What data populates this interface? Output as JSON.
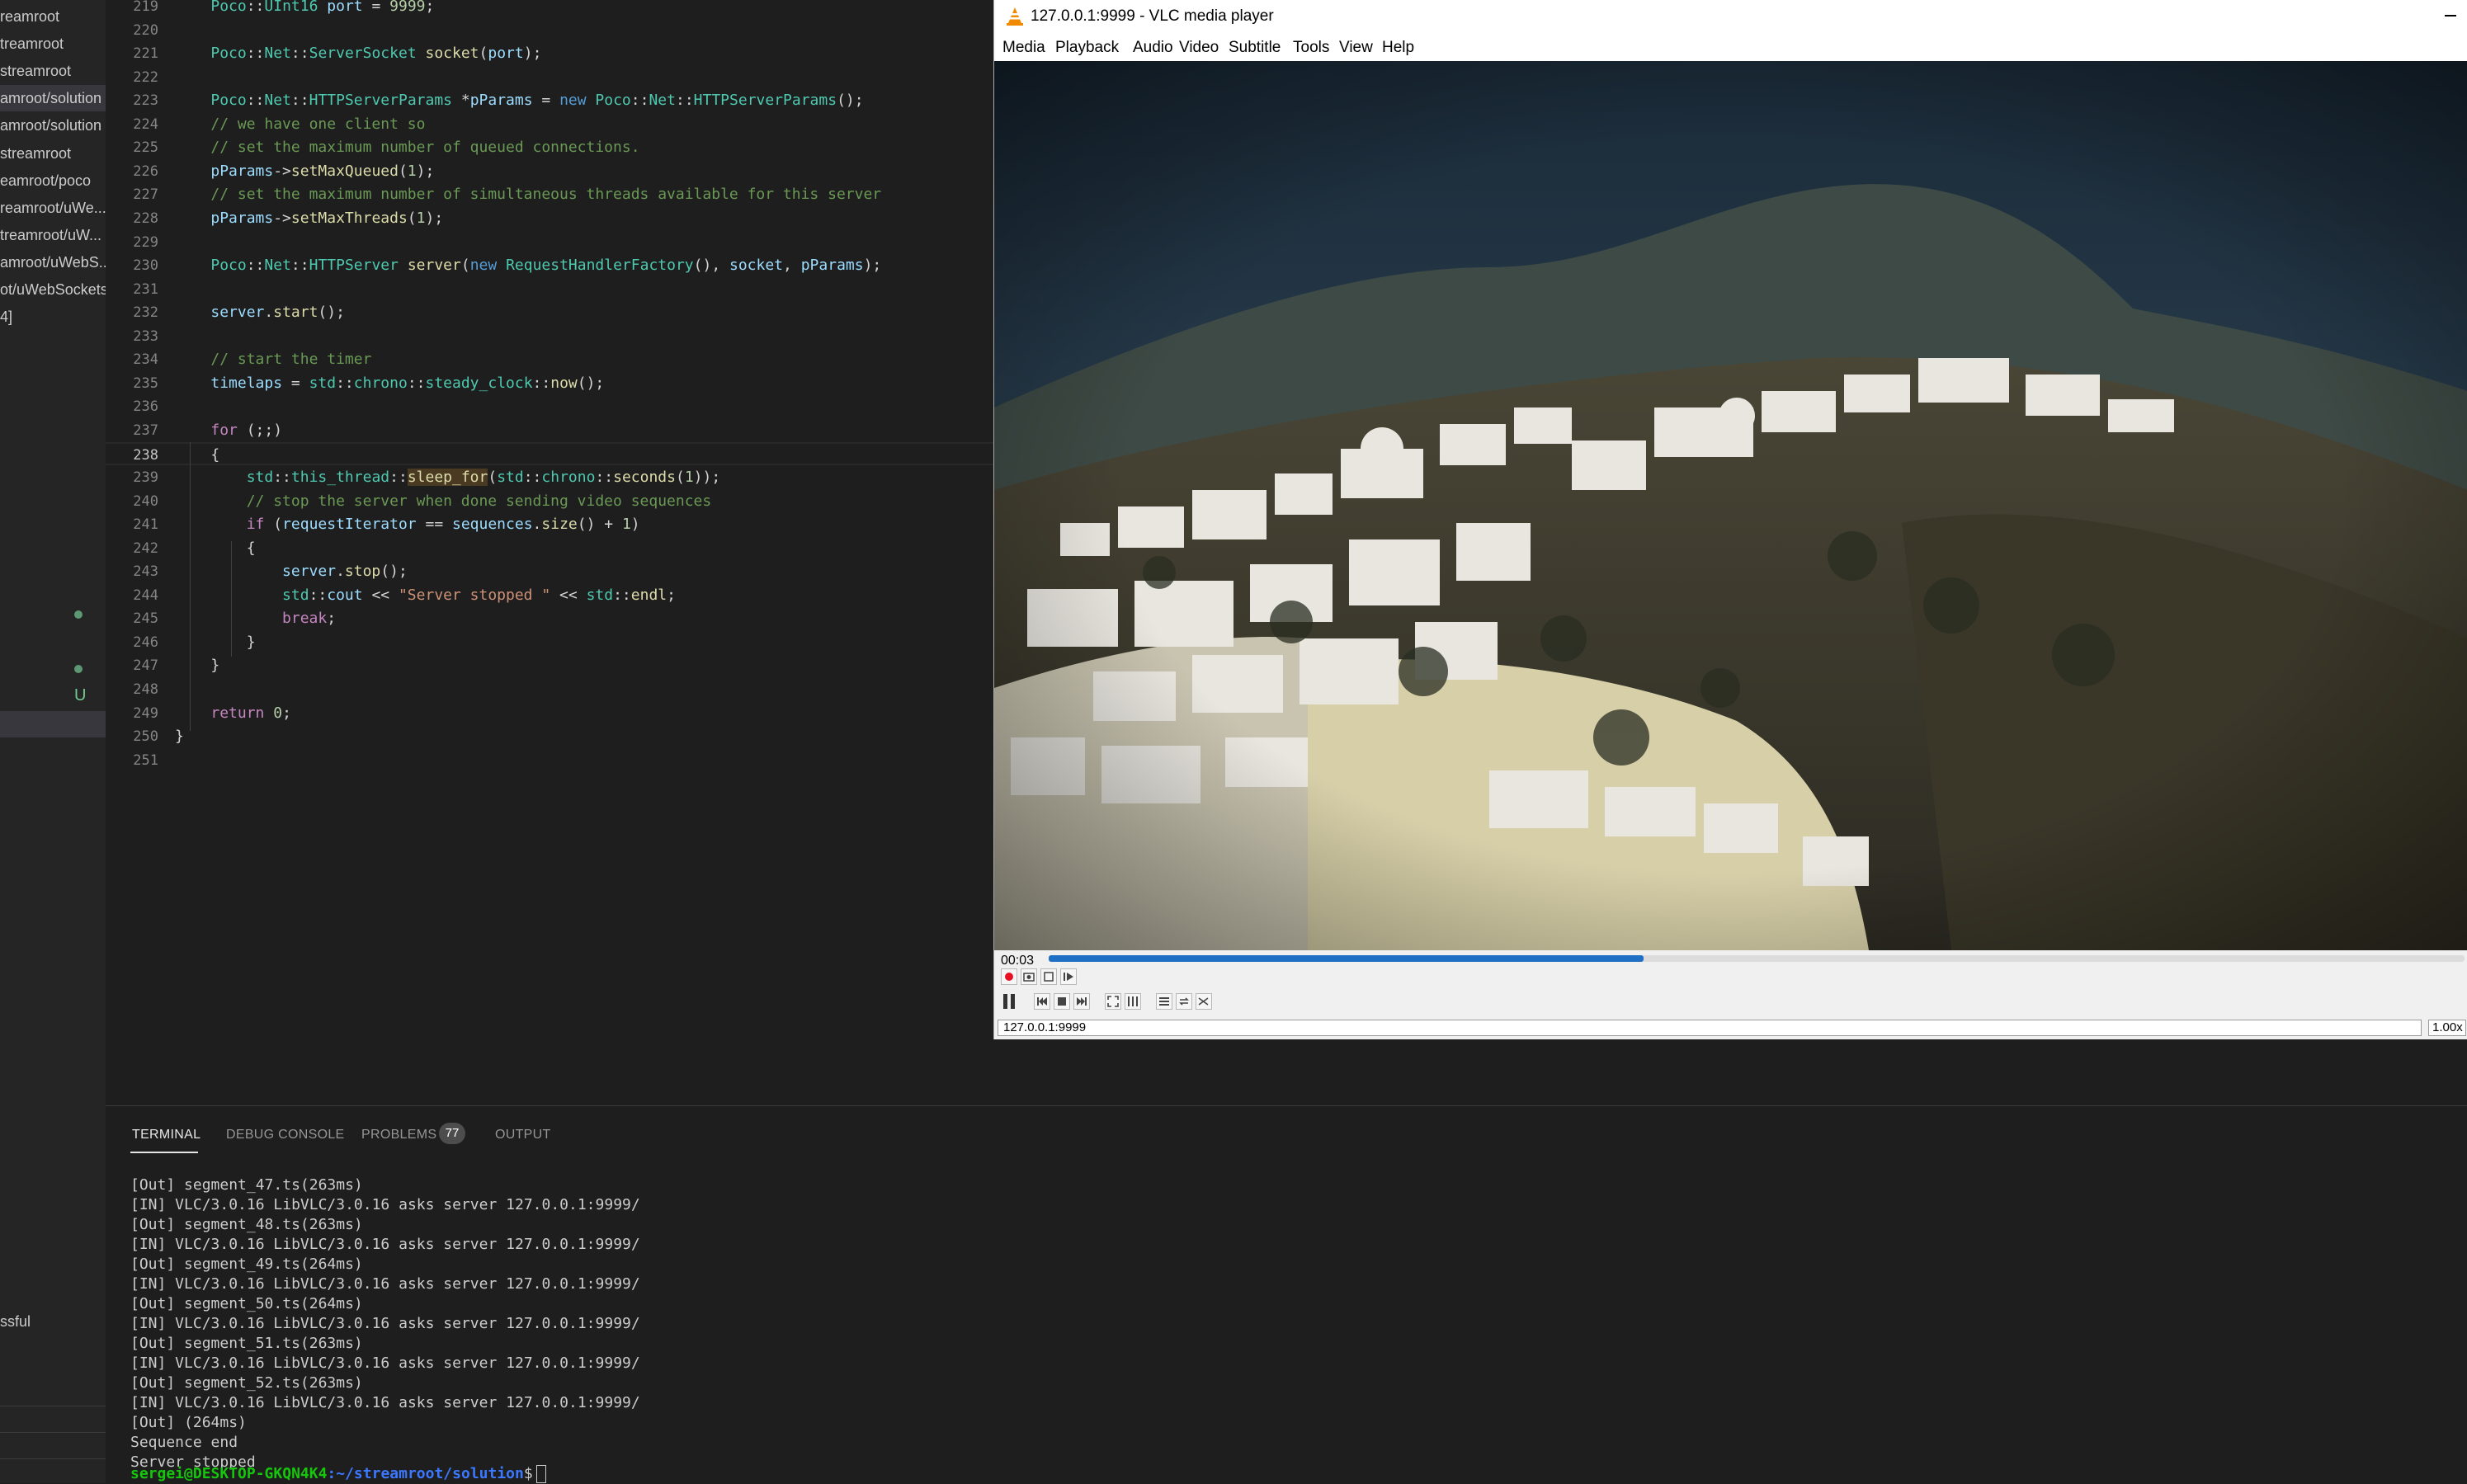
{
  "sidebar": {
    "items": [
      "reamroot",
      "treamroot",
      "streamroot",
      "amroot/solution",
      "amroot/solution",
      "streamroot",
      "eamroot/poco",
      "reamroot/uWe...",
      "treamroot/uW...",
      "amroot/uWebS...",
      "ot/uWebSockets",
      "4]"
    ],
    "badge_u": "U",
    "bottom_text": "ssful"
  },
  "editor": {
    "lines": [
      {
        "n": "219",
        "html": "    <span class='t'>Poco</span>::<span class='t'>UInt16</span> <span class='v'>port</span> = <span class='n'>9999</span>;"
      },
      {
        "n": "220",
        "html": ""
      },
      {
        "n": "221",
        "html": "    <span class='t'>Poco</span>::<span class='t'>Net</span>::<span class='t'>ServerSocket</span> <span class='f'>socket</span>(<span class='v'>port</span>);"
      },
      {
        "n": "222",
        "html": ""
      },
      {
        "n": "223",
        "html": "    <span class='t'>Poco</span>::<span class='t'>Net</span>::<span class='t'>HTTPServerParams</span> *<span class='v'>pParams</span> = <span class='k'>new</span> <span class='t'>Poco</span>::<span class='t'>Net</span>::<span class='t'>HTTPServerParams</span>();"
      },
      {
        "n": "224",
        "html": "    <span class='cm'>// we have one client so</span>"
      },
      {
        "n": "225",
        "html": "    <span class='cm'>// set the maximum number of queued connections.</span>"
      },
      {
        "n": "226",
        "html": "    <span class='v'>pParams</span>-&gt;<span class='f'>setMaxQueued</span>(<span class='n'>1</span>);"
      },
      {
        "n": "227",
        "html": "    <span class='cm'>// set the maximum number of simultaneous threads available for this server</span>"
      },
      {
        "n": "228",
        "html": "    <span class='v'>pParams</span>-&gt;<span class='f'>setMaxThreads</span>(<span class='n'>1</span>);"
      },
      {
        "n": "229",
        "html": ""
      },
      {
        "n": "230",
        "html": "    <span class='t'>Poco</span>::<span class='t'>Net</span>::<span class='t'>HTTPServer</span> <span class='f'>server</span>(<span class='k'>new</span> <span class='t'>RequestHandlerFactory</span>(), <span class='v'>socket</span>, <span class='v'>pParams</span>);"
      },
      {
        "n": "231",
        "html": ""
      },
      {
        "n": "232",
        "html": "    <span class='v'>server</span>.<span class='f'>start</span>();"
      },
      {
        "n": "233",
        "html": ""
      },
      {
        "n": "234",
        "html": "    <span class='cm'>// start the timer</span>"
      },
      {
        "n": "235",
        "html": "    <span class='v'>timelaps</span> = <span class='t'>std</span>::<span class='t'>chrono</span>::<span class='t'>steady_clock</span>::<span class='f'>now</span>();"
      },
      {
        "n": "236",
        "html": ""
      },
      {
        "n": "237",
        "html": "    <span class='c'>for</span> (;;)"
      },
      {
        "n": "238",
        "html": "    {"
      },
      {
        "n": "239",
        "html": "        <span class='t'>std</span>::<span class='t'>this_thread</span>::<span class='f hlw'>sleep_for</span>(<span class='t'>std</span>::<span class='t'>chrono</span>::<span class='f'>seconds</span>(<span class='n'>1</span>));"
      },
      {
        "n": "240",
        "html": "        <span class='cm'>// stop the server when done sending video sequences</span>"
      },
      {
        "n": "241",
        "html": "        <span class='c'>if</span> (<span class='v'>requestIterator</span> == <span class='v'>sequences</span>.<span class='f'>size</span>() + <span class='n'>1</span>)"
      },
      {
        "n": "242",
        "html": "        {"
      },
      {
        "n": "243",
        "html": "            <span class='v'>server</span>.<span class='f'>stop</span>();"
      },
      {
        "n": "244",
        "html": "            <span class='t'>std</span>::<span class='v'>cout</span> &lt;&lt; <span class='s'>\"Server stopped \"</span> &lt;&lt; <span class='t'>std</span>::<span class='f'>endl</span>;"
      },
      {
        "n": "245",
        "html": "            <span class='c'>break</span>;"
      },
      {
        "n": "246",
        "html": "        }"
      },
      {
        "n": "247",
        "html": "    }"
      },
      {
        "n": "248",
        "html": ""
      },
      {
        "n": "249",
        "html": "    <span class='c'>return</span> <span class='n'>0</span>;"
      },
      {
        "n": "250",
        "html": "}"
      },
      {
        "n": "251",
        "html": ""
      }
    ],
    "current_line": "238"
  },
  "vlc": {
    "title": "127.0.0.1:9999 - VLC media player",
    "menu": [
      "Media",
      "Playback",
      "Audio",
      "Video",
      "Subtitle",
      "Tools",
      "View",
      "Help"
    ],
    "time_elapsed": "00:03",
    "progress": 0.42,
    "status_url": "127.0.0.1:9999",
    "speed": "1.00x",
    "colors": {
      "progress": "#1f6fc4",
      "record": "#e81123"
    }
  },
  "panel": {
    "tabs": [
      "TERMINAL",
      "DEBUG CONSOLE",
      "PROBLEMS",
      "OUTPUT"
    ],
    "problems_count": "77",
    "terminal_lines": [
      "[Out] segment_47.ts(263ms)",
      "[IN] VLC/3.0.16 LibVLC/3.0.16 asks server 127.0.0.1:9999/",
      "[Out] segment_48.ts(263ms)",
      "[IN] VLC/3.0.16 LibVLC/3.0.16 asks server 127.0.0.1:9999/",
      "[Out] segment_49.ts(264ms)",
      "[IN] VLC/3.0.16 LibVLC/3.0.16 asks server 127.0.0.1:9999/",
      "[Out] segment_50.ts(264ms)",
      "[IN] VLC/3.0.16 LibVLC/3.0.16 asks server 127.0.0.1:9999/",
      "[Out] segment_51.ts(263ms)",
      "[IN] VLC/3.0.16 LibVLC/3.0.16 asks server 127.0.0.1:9999/",
      "[Out] segment_52.ts(263ms)",
      "[IN] VLC/3.0.16 LibVLC/3.0.16 asks server 127.0.0.1:9999/",
      "[Out] (264ms)",
      "Sequence end",
      "Server stopped"
    ],
    "prompt_user": "sergei@DESKTOP-GKQN4K4",
    "prompt_path": ":~/streamroot/solution",
    "prompt_symbol": "$"
  }
}
